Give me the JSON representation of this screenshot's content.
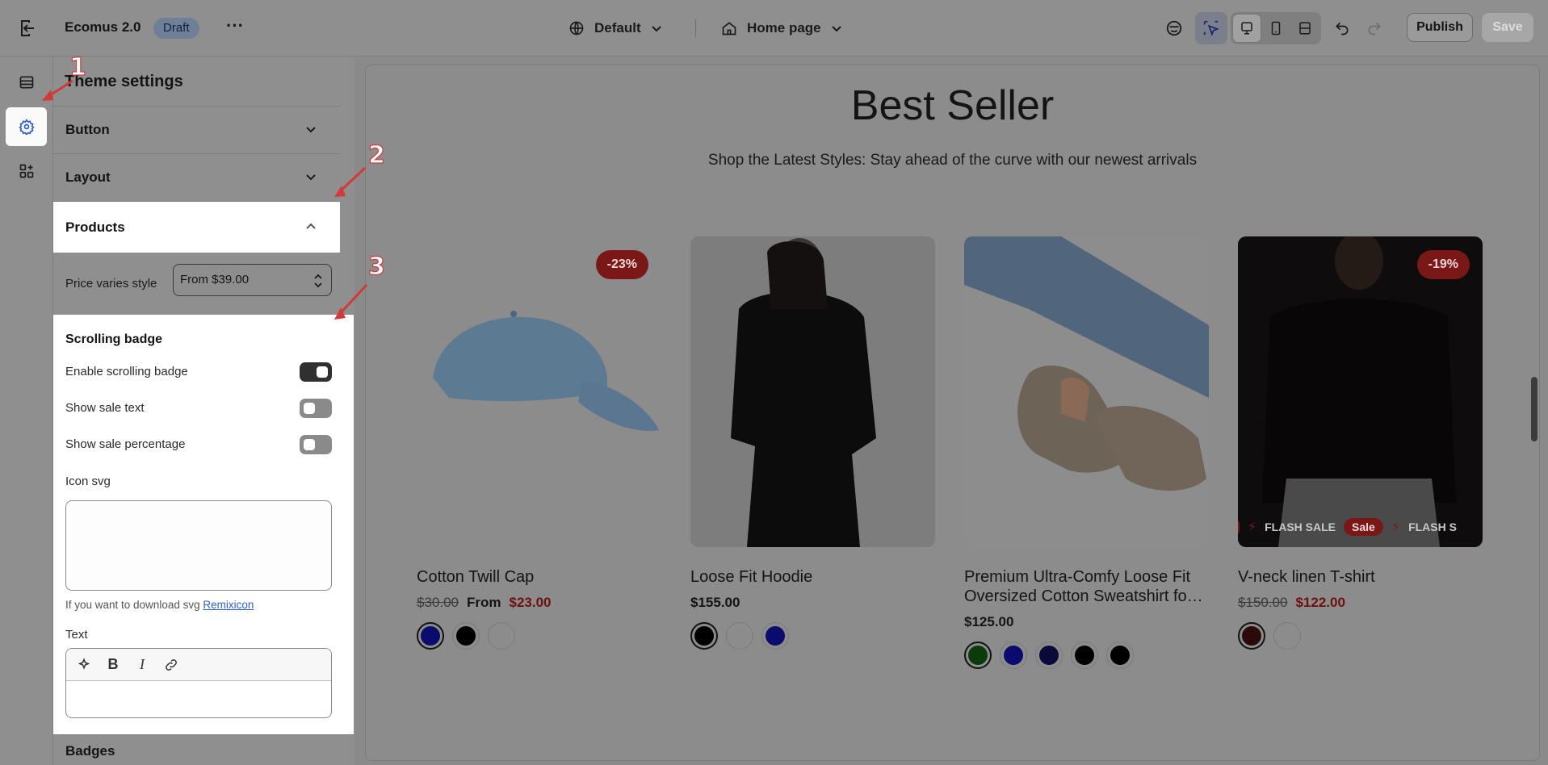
{
  "topbar": {
    "app_title": "Ecomus 2.0",
    "status_badge": "Draft",
    "more_label": "···",
    "language_selector": "Default",
    "page_selector": "Home page",
    "publish_label": "Publish",
    "save_label": "Save"
  },
  "panel": {
    "title": "Theme settings",
    "sections": {
      "button": "Button",
      "layout": "Layout",
      "products": "Products",
      "badges": "Badges"
    },
    "price_varies": {
      "label": "Price varies style",
      "value": "From $39.00"
    },
    "scrolling_badge": {
      "title": "Scrolling badge",
      "enable_label": "Enable scrolling badge",
      "enable_on": true,
      "sale_text_label": "Show sale text",
      "sale_text_on": false,
      "sale_pct_label": "Show sale percentage",
      "sale_pct_on": false,
      "icon_svg_label": "Icon svg",
      "help_prefix": "If you want to download svg ",
      "help_link": "Remixicon",
      "text_label": "Text"
    }
  },
  "preview": {
    "heading": "Best Seller",
    "subheading": "Shop the Latest Styles: Stay ahead of the curve with our newest arrivals",
    "products": [
      {
        "name": "Cotton Twill Cap",
        "badge": "-23%",
        "old_price": "$30.00",
        "price_prefix": "From",
        "price": "$23.00",
        "swatches": [
          "#0b0b6e",
          "#000000",
          "#8c8c8c"
        ]
      },
      {
        "name": "Loose Fit Hoodie",
        "badge": "",
        "old_price": "",
        "price_prefix": "",
        "price": "$155.00",
        "swatches": [
          "#000000",
          "#8c8c8c",
          "#0b0b6e"
        ]
      },
      {
        "name": "Premium Ultra-Comfy Loose Fit Oversized Cotton Sweatshirt fo…",
        "badge": "",
        "old_price": "",
        "price_prefix": "",
        "price": "$125.00",
        "swatches": [
          "#0b3a0b",
          "#0b0b6e",
          "#0a0a3a",
          "#000000",
          "#000000"
        ]
      },
      {
        "name": "V-neck linen T-shirt",
        "badge": "-19%",
        "old_price": "$150.00",
        "price_prefix": "",
        "price": "$122.00",
        "swatches": [
          "#2a0a0a",
          "#8c8c8c"
        ],
        "marquee": [
          "FLASH SALE",
          "Sale",
          "FLASH S"
        ]
      }
    ]
  },
  "annotations": [
    "1",
    "2",
    "3"
  ],
  "colors": {
    "sale_red": "#7a1818",
    "accent_blue": "#2c5ec9"
  }
}
